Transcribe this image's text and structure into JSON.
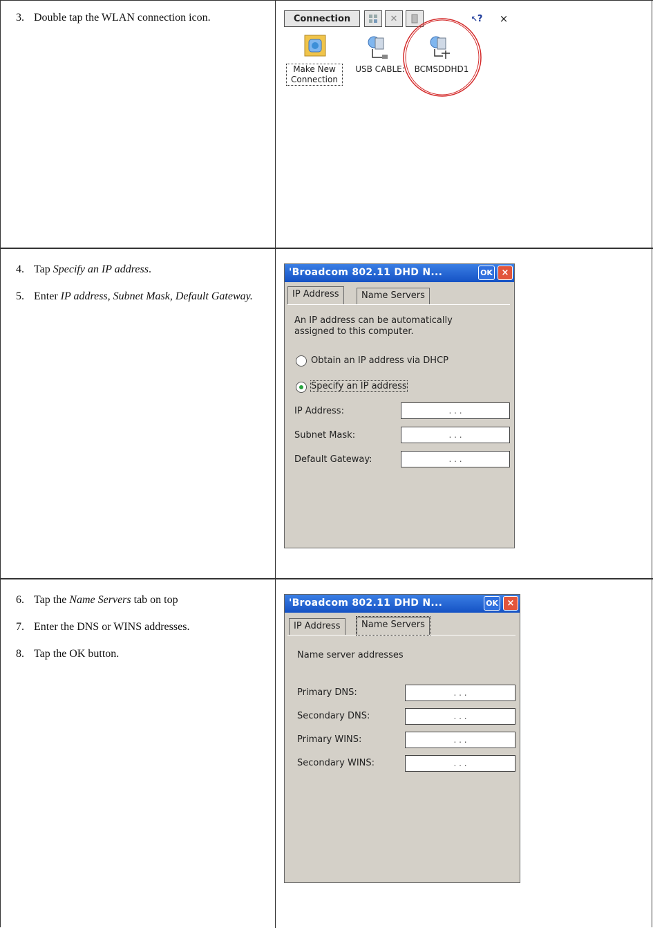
{
  "rows": [
    {
      "steps": [
        {
          "num": "3.",
          "text": "Double tap the WLAN connection icon."
        }
      ],
      "screen": {
        "toolbar": {
          "title": "Connection",
          "help": "?",
          "close": "×"
        },
        "icons": [
          {
            "label_line1": "Make New",
            "label_line2": "Connection",
            "icon": "make-new-connection-icon"
          },
          {
            "label": "USB CABLE:",
            "icon": "network-cable-icon"
          },
          {
            "label": "BCMSDDHD1",
            "icon": "wlan-connection-icon"
          }
        ]
      }
    },
    {
      "steps": [
        {
          "num": "4.",
          "pre": "Tap ",
          "em": "Specify an IP address",
          "post": "."
        },
        {
          "num": "5.",
          "pre": "Enter ",
          "em": "IP address, Subnet Mask, Default Gateway.",
          "post": ""
        }
      ],
      "dialog": {
        "title": "'Broadcom 802.11 DHD N...",
        "ok": "OK",
        "close": "×",
        "tabs": [
          "IP Address",
          "Name Servers"
        ],
        "intro_line1": "An IP address can be automatically",
        "intro_line2": "assigned to this computer.",
        "radio_dhcp": "Obtain an IP address via DHCP",
        "radio_specify": "Specify an IP address",
        "fields": [
          {
            "label": "IP Address:",
            "value": ". . ."
          },
          {
            "label": "Subnet Mask:",
            "value": ". . ."
          },
          {
            "label": "Default Gateway:",
            "value": ". . ."
          }
        ]
      }
    },
    {
      "steps": [
        {
          "num": "6.",
          "pre": "Tap the ",
          "em": "Name Servers",
          "post": " tab on top"
        },
        {
          "num": "7.",
          "pre": "Enter the DNS or WINS addresses.",
          "em": "",
          "post": ""
        },
        {
          "num": "8.",
          "pre": "Tap the OK button.",
          "em": "",
          "post": ""
        }
      ],
      "dialog": {
        "title": "'Broadcom 802.11 DHD N...",
        "ok": "OK",
        "close": "×",
        "tabs": [
          "IP Address",
          "Name Servers"
        ],
        "intro": "Name server addresses",
        "fields": [
          {
            "label": "Primary DNS:",
            "value": ". . ."
          },
          {
            "label": "Secondary DNS:",
            "value": ". . ."
          },
          {
            "label": "Primary WINS:",
            "value": ". . ."
          },
          {
            "label": "Secondary WINS:",
            "value": ". . ."
          }
        ]
      }
    }
  ],
  "colors": {
    "highlight_circle": "#d42a2a",
    "titlebar": "#1f5fd0",
    "dialog_bg": "#d4d0c8"
  }
}
